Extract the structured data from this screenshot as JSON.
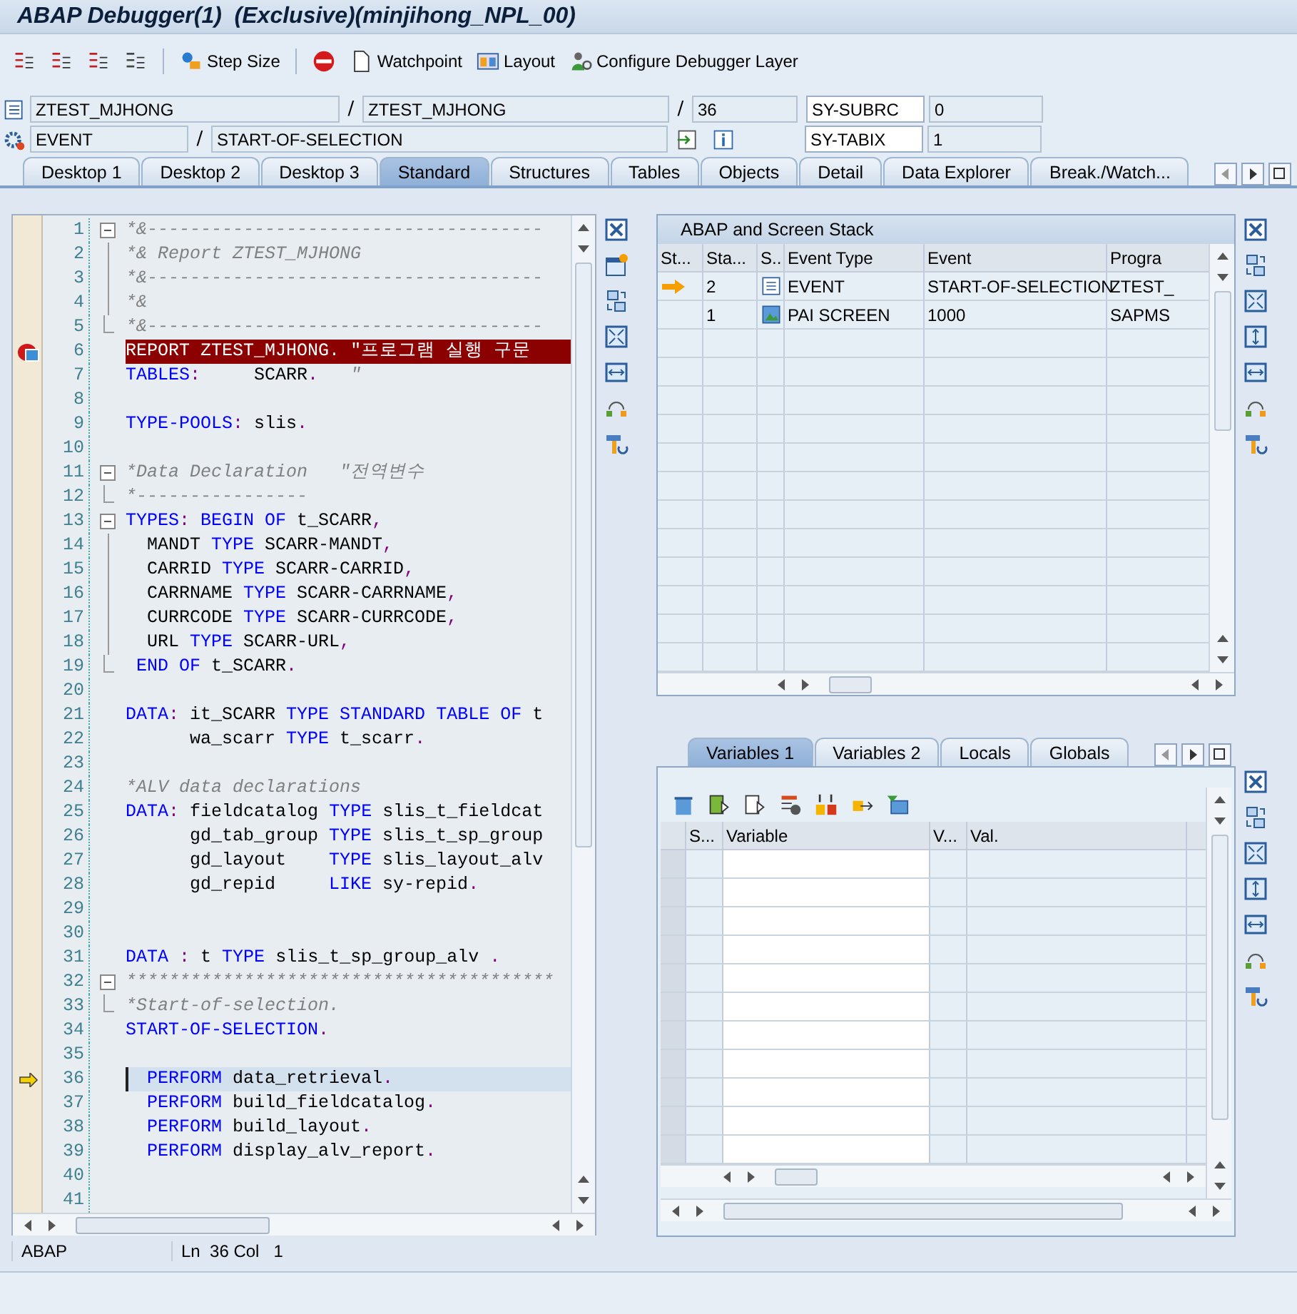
{
  "window": {
    "title": "ABAP Debugger(1)  (Exclusive)(minjihong_NPL_00)"
  },
  "toolbar_buttons": [
    "Step Size",
    "Watchpoint",
    "Layout",
    "Configure Debugger Layer"
  ],
  "location_rows": [
    {
      "fields": [
        "ZTEST_MJHONG",
        "ZTEST_MJHONG",
        "36"
      ],
      "separators": [
        "/",
        "/"
      ],
      "sy_name": "SY-SUBRC",
      "sy_value": "0"
    },
    {
      "fields": [
        "EVENT",
        "START-OF-SELECTION"
      ],
      "separators": [
        "/"
      ],
      "sy_name": "SY-TABIX",
      "sy_value": "1"
    }
  ],
  "tabs": [
    {
      "label": "Desktop 1",
      "selected": false
    },
    {
      "label": "Desktop 2",
      "selected": false
    },
    {
      "label": "Desktop 3",
      "selected": false
    },
    {
      "label": "Standard",
      "selected": true
    },
    {
      "label": "Structures",
      "selected": false
    },
    {
      "label": "Tables",
      "selected": false
    },
    {
      "label": "Objects",
      "selected": false
    },
    {
      "label": "Detail",
      "selected": false
    },
    {
      "label": "Data Explorer",
      "selected": false
    },
    {
      "label": "Break./Watch...",
      "selected": false
    }
  ],
  "code": {
    "lines": [
      {
        "number": "1",
        "kind": "open",
        "breakpoint": false,
        "current": false,
        "tokens": [
          {
            "kind": "comment",
            "text": "*&-------------------------------------"
          }
        ]
      },
      {
        "number": "2",
        "kind": "inner",
        "breakpoint": false,
        "current": false,
        "tokens": [
          {
            "kind": "comment",
            "text": "*& Report ZTEST_MJHONG"
          }
        ]
      },
      {
        "number": "3",
        "kind": "inner",
        "breakpoint": false,
        "current": false,
        "tokens": [
          {
            "kind": "comment",
            "text": "*&-------------------------------------"
          }
        ]
      },
      {
        "number": "4",
        "kind": "inner",
        "breakpoint": false,
        "current": false,
        "tokens": [
          {
            "kind": "comment",
            "text": "*&"
          }
        ]
      },
      {
        "number": "5",
        "kind": "close",
        "breakpoint": false,
        "current": false,
        "tokens": [
          {
            "kind": "comment",
            "text": "*&-------------------------------------"
          }
        ]
      },
      {
        "number": "6",
        "kind": "plain",
        "breakpoint": true,
        "current": false,
        "tokens": [
          {
            "kind": "kw",
            "text": "REPORT"
          },
          {
            "kind": "id",
            "text": " ZTEST_MJHONG"
          },
          {
            "kind": "punct",
            "text": "."
          },
          {
            "kind": "comment",
            "text": " \"프로그램 실행 구문"
          }
        ]
      },
      {
        "number": "7",
        "kind": "plain",
        "breakpoint": false,
        "current": false,
        "tokens": [
          {
            "kind": "kw",
            "text": "TABLES"
          },
          {
            "kind": "punct",
            "text": ":"
          },
          {
            "kind": "id",
            "text": "     SCARR"
          },
          {
            "kind": "punct",
            "text": "."
          },
          {
            "kind": "comment",
            "text": "   \""
          }
        ]
      },
      {
        "number": "8",
        "kind": "plain",
        "breakpoint": false,
        "current": false
      },
      {
        "number": "9",
        "kind": "plain",
        "breakpoint": false,
        "current": false,
        "tokens": [
          {
            "kind": "kw",
            "text": "TYPE-POOLS"
          },
          {
            "kind": "punct",
            "text": ":"
          },
          {
            "kind": "id",
            "text": " slis"
          },
          {
            "kind": "punct",
            "text": "."
          }
        ]
      },
      {
        "number": "10",
        "kind": "plain",
        "breakpoint": false,
        "current": false
      },
      {
        "number": "11",
        "kind": "open",
        "breakpoint": false,
        "current": false,
        "tokens": [
          {
            "kind": "comment",
            "text": "*Data Declaration   \"전역변수"
          }
        ]
      },
      {
        "number": "12",
        "kind": "close",
        "breakpoint": false,
        "current": false,
        "tokens": [
          {
            "kind": "comment",
            "text": "*----------------"
          }
        ]
      },
      {
        "number": "13",
        "kind": "open",
        "breakpoint": false,
        "current": false,
        "tokens": [
          {
            "kind": "kw",
            "text": "TYPES"
          },
          {
            "kind": "punct",
            "text": ":"
          },
          {
            "kind": "kw",
            "text": " BEGIN OF"
          },
          {
            "kind": "id",
            "text": " t_SCARR"
          },
          {
            "kind": "punct",
            "text": ","
          }
        ]
      },
      {
        "number": "14",
        "kind": "inner",
        "breakpoint": false,
        "current": false,
        "tokens": [
          {
            "kind": "id",
            "text": "  MANDT "
          },
          {
            "kind": "kw",
            "text": "TYPE"
          },
          {
            "kind": "id",
            "text": " SCARR-MANDT"
          },
          {
            "kind": "punct",
            "text": ","
          }
        ]
      },
      {
        "number": "15",
        "kind": "inner",
        "breakpoint": false,
        "current": false,
        "tokens": [
          {
            "kind": "id",
            "text": "  CARRID "
          },
          {
            "kind": "kw",
            "text": "TYPE"
          },
          {
            "kind": "id",
            "text": " SCARR-CARRID"
          },
          {
            "kind": "punct",
            "text": ","
          }
        ]
      },
      {
        "number": "16",
        "kind": "inner",
        "breakpoint": false,
        "current": false,
        "tokens": [
          {
            "kind": "id",
            "text": "  CARRNAME "
          },
          {
            "kind": "kw",
            "text": "TYPE"
          },
          {
            "kind": "id",
            "text": " SCARR-CARRNAME"
          },
          {
            "kind": "punct",
            "text": ","
          }
        ]
      },
      {
        "number": "17",
        "kind": "inner",
        "breakpoint": false,
        "current": false,
        "tokens": [
          {
            "kind": "id",
            "text": "  CURRCODE "
          },
          {
            "kind": "kw",
            "text": "TYPE"
          },
          {
            "kind": "id",
            "text": " SCARR-CURRCODE"
          },
          {
            "kind": "punct",
            "text": ","
          }
        ]
      },
      {
        "number": "18",
        "kind": "inner",
        "breakpoint": false,
        "current": false,
        "tokens": [
          {
            "kind": "id",
            "text": "  URL "
          },
          {
            "kind": "kw",
            "text": "TYPE"
          },
          {
            "kind": "id",
            "text": " SCARR-URL"
          },
          {
            "kind": "punct",
            "text": ","
          }
        ]
      },
      {
        "number": "19",
        "kind": "close",
        "breakpoint": false,
        "current": false,
        "tokens": [
          {
            "kind": "kw",
            "text": " END OF"
          },
          {
            "kind": "id",
            "text": " t_SCARR"
          },
          {
            "kind": "punct",
            "text": "."
          }
        ]
      },
      {
        "number": "20",
        "kind": "plain",
        "breakpoint": false,
        "current": false
      },
      {
        "number": "21",
        "kind": "plain",
        "breakpoint": false,
        "current": false,
        "tokens": [
          {
            "kind": "kw",
            "text": "DATA"
          },
          {
            "kind": "punct",
            "text": ":"
          },
          {
            "kind": "id",
            "text": " it_SCARR "
          },
          {
            "kind": "kw",
            "text": "TYPE STANDARD TABLE OF"
          },
          {
            "kind": "id",
            "text": " t"
          }
        ]
      },
      {
        "number": "22",
        "kind": "plain",
        "breakpoint": false,
        "current": false,
        "tokens": [
          {
            "kind": "id",
            "text": "      wa_scarr "
          },
          {
            "kind": "kw",
            "text": "TYPE"
          },
          {
            "kind": "id",
            "text": " t_scarr"
          },
          {
            "kind": "punct",
            "text": "."
          }
        ]
      },
      {
        "number": "23",
        "kind": "plain",
        "breakpoint": false,
        "current": false
      },
      {
        "number": "24",
        "kind": "plain",
        "breakpoint": false,
        "current": false,
        "tokens": [
          {
            "kind": "comment",
            "text": "*ALV data declarations"
          }
        ]
      },
      {
        "number": "25",
        "kind": "plain",
        "breakpoint": false,
        "current": false,
        "tokens": [
          {
            "kind": "kw",
            "text": "DATA"
          },
          {
            "kind": "punct",
            "text": ":"
          },
          {
            "kind": "id",
            "text": " fieldcatalog "
          },
          {
            "kind": "kw",
            "text": "TYPE"
          },
          {
            "kind": "id",
            "text": " slis_t_fieldcat"
          }
        ]
      },
      {
        "number": "26",
        "kind": "plain",
        "breakpoint": false,
        "current": false,
        "tokens": [
          {
            "kind": "id",
            "text": "      gd_tab_group "
          },
          {
            "kind": "kw",
            "text": "TYPE"
          },
          {
            "kind": "id",
            "text": " slis_t_sp_group"
          }
        ]
      },
      {
        "number": "27",
        "kind": "plain",
        "breakpoint": false,
        "current": false,
        "tokens": [
          {
            "kind": "id",
            "text": "      gd_layout    "
          },
          {
            "kind": "kw",
            "text": "TYPE"
          },
          {
            "kind": "id",
            "text": " slis_layout_alv"
          }
        ]
      },
      {
        "number": "28",
        "kind": "plain",
        "breakpoint": false,
        "current": false,
        "tokens": [
          {
            "kind": "id",
            "text": "      gd_repid     "
          },
          {
            "kind": "kw",
            "text": "LIKE"
          },
          {
            "kind": "id",
            "text": " sy-repid"
          },
          {
            "kind": "punct",
            "text": "."
          }
        ]
      },
      {
        "number": "29",
        "kind": "plain",
        "breakpoint": false,
        "current": false
      },
      {
        "number": "30",
        "kind": "plain",
        "breakpoint": false,
        "current": false
      },
      {
        "number": "31",
        "kind": "plain",
        "breakpoint": false,
        "current": false,
        "tokens": [
          {
            "kind": "kw",
            "text": "DATA"
          },
          {
            "kind": "punct",
            "text": " :"
          },
          {
            "kind": "id",
            "text": " t "
          },
          {
            "kind": "kw",
            "text": "TYPE"
          },
          {
            "kind": "id",
            "text": " slis_t_sp_group_alv "
          },
          {
            "kind": "punct",
            "text": "."
          }
        ]
      },
      {
        "number": "32",
        "kind": "open",
        "breakpoint": false,
        "current": false,
        "tokens": [
          {
            "kind": "comment",
            "text": "****************************************"
          }
        ]
      },
      {
        "number": "33",
        "kind": "close",
        "breakpoint": false,
        "current": false,
        "tokens": [
          {
            "kind": "comment",
            "text": "*Start-of-selection."
          }
        ]
      },
      {
        "number": "34",
        "kind": "plain",
        "breakpoint": false,
        "current": false,
        "tokens": [
          {
            "kind": "kw",
            "text": "START-OF-SELECTION"
          },
          {
            "kind": "punct",
            "text": "."
          }
        ]
      },
      {
        "number": "35",
        "kind": "plain",
        "breakpoint": false,
        "current": false
      },
      {
        "number": "36",
        "kind": "plain",
        "breakpoint": false,
        "current": true,
        "tokens": [
          {
            "kind": "kw",
            "text": "  PERFORM"
          },
          {
            "kind": "id",
            "text": " data_retrieval"
          },
          {
            "kind": "punct",
            "text": "."
          }
        ]
      },
      {
        "number": "37",
        "kind": "plain",
        "breakpoint": false,
        "current": false,
        "tokens": [
          {
            "kind": "kw",
            "text": "  PERFORM"
          },
          {
            "kind": "id",
            "text": " build_fieldcatalog"
          },
          {
            "kind": "punct",
            "text": "."
          }
        ]
      },
      {
        "number": "38",
        "kind": "plain",
        "breakpoint": false,
        "current": false,
        "tokens": [
          {
            "kind": "kw",
            "text": "  PERFORM"
          },
          {
            "kind": "id",
            "text": " build_layout"
          },
          {
            "kind": "punct",
            "text": "."
          }
        ]
      },
      {
        "number": "39",
        "kind": "plain",
        "breakpoint": false,
        "current": false,
        "tokens": [
          {
            "kind": "kw",
            "text": "  PERFORM"
          },
          {
            "kind": "id",
            "text": " display_alv_report"
          },
          {
            "kind": "punct",
            "text": "."
          }
        ]
      },
      {
        "number": "40",
        "kind": "plain",
        "breakpoint": false,
        "current": false
      },
      {
        "number": "41",
        "kind": "plain",
        "breakpoint": false,
        "current": false
      }
    ]
  },
  "status_bar": {
    "language": "ABAP",
    "position": "Ln  36 Col   1"
  },
  "stack": {
    "title": "ABAP and Screen Stack",
    "columns": [
      "St...",
      "Sta...",
      "S..",
      "Event Type",
      "Event",
      "Progra"
    ],
    "rows": [
      {
        "current": true,
        "kind": "event",
        "cells": [
          "",
          "2",
          "",
          "EVENT",
          "START-OF-SELECTION",
          "ZTEST_"
        ]
      },
      {
        "current": false,
        "kind": "screen",
        "cells": [
          "",
          "1",
          "",
          "PAI SCREEN",
          "1000",
          "SAPMS"
        ]
      }
    ]
  },
  "variables": {
    "tabs": [
      {
        "label": "Variables 1",
        "selected": true
      },
      {
        "label": "Variables 2",
        "selected": false
      },
      {
        "label": "Locals",
        "selected": false
      },
      {
        "label": "Globals",
        "selected": false
      }
    ],
    "columns": [
      "S...",
      "Variable",
      "V...",
      "Val."
    ]
  }
}
